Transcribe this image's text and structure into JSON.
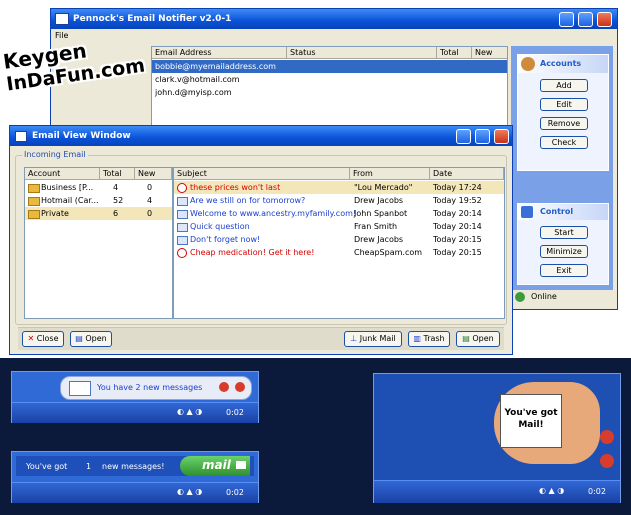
{
  "main_window": {
    "title": "Pennock's Email Notifier v2.0-1",
    "menu": "File",
    "columns": [
      "Email Address",
      "Status",
      "Total",
      "New"
    ],
    "rows": [
      {
        "address": "bobbie@myemailaddress.com",
        "status": "",
        "total": "",
        "new": ""
      },
      {
        "address": "clark.v@hotmail.com",
        "status": "",
        "total": "",
        "new": ""
      },
      {
        "address": "john.d@myisp.com",
        "status": "",
        "total": "",
        "new": ""
      }
    ],
    "accounts_panel": {
      "title": "Accounts",
      "buttons": [
        "Add",
        "Edit",
        "Remove",
        "Check"
      ]
    },
    "control_panel": {
      "title": "Control",
      "buttons": [
        "Start",
        "Minimize",
        "Exit"
      ]
    },
    "status": "Online"
  },
  "watermark": {
    "line1": "Keygen",
    "line2": "InDaFun.com"
  },
  "view_window": {
    "title": "Email View Window",
    "group_label": "Incoming Email",
    "account_columns": [
      "Account",
      "Total",
      "New"
    ],
    "accounts": [
      {
        "name": "Business [P...",
        "total": "4",
        "new": "0"
      },
      {
        "name": "Hotmail (Car...",
        "total": "52",
        "new": "4"
      },
      {
        "name": "Private",
        "total": "6",
        "new": "0"
      }
    ],
    "mail_columns": [
      "Subject",
      "From",
      "Date"
    ],
    "mails": [
      {
        "subject": "these prices won't last",
        "from": "\"Lou Mercado\"",
        "date": "Today 17:24",
        "kind": "spam"
      },
      {
        "subject": "Are we still on for tomorrow?",
        "from": "Drew Jacobs",
        "date": "Today 19:52",
        "kind": "mail"
      },
      {
        "subject": "Welcome to www.ancestry.myfamily.com!",
        "from": "John Spanbot",
        "date": "Today 20:14",
        "kind": "mail"
      },
      {
        "subject": "Quick question",
        "from": "Fran Smith",
        "date": "Today 20:14",
        "kind": "mail"
      },
      {
        "subject": "Don't forget now!",
        "from": "Drew Jacobs",
        "date": "Today 20:15",
        "kind": "mail"
      },
      {
        "subject": "Cheap medication! Get it here!",
        "from": "CheapSpam.com",
        "date": "Today 20:15",
        "kind": "spam"
      }
    ],
    "buttons": {
      "close": "Close",
      "open_left": "Open",
      "junk": "Junk Mail",
      "trash": "Trash",
      "open_right": "Open"
    }
  },
  "popup1": {
    "message": "You have 2 new messages",
    "clock": "0:02"
  },
  "popup2": {
    "prefix": "You've got",
    "count": "1",
    "suffix": "new messages!",
    "brand": "mail",
    "clock": "0:02"
  },
  "popup3": {
    "card_text": "You've got Mail!",
    "clock": "0:02"
  },
  "colors": {
    "xp_blue": "#0a52d8",
    "spam_red": "#d40000",
    "link_blue": "#1a3fd0",
    "desktop": "#0b1a3a"
  }
}
